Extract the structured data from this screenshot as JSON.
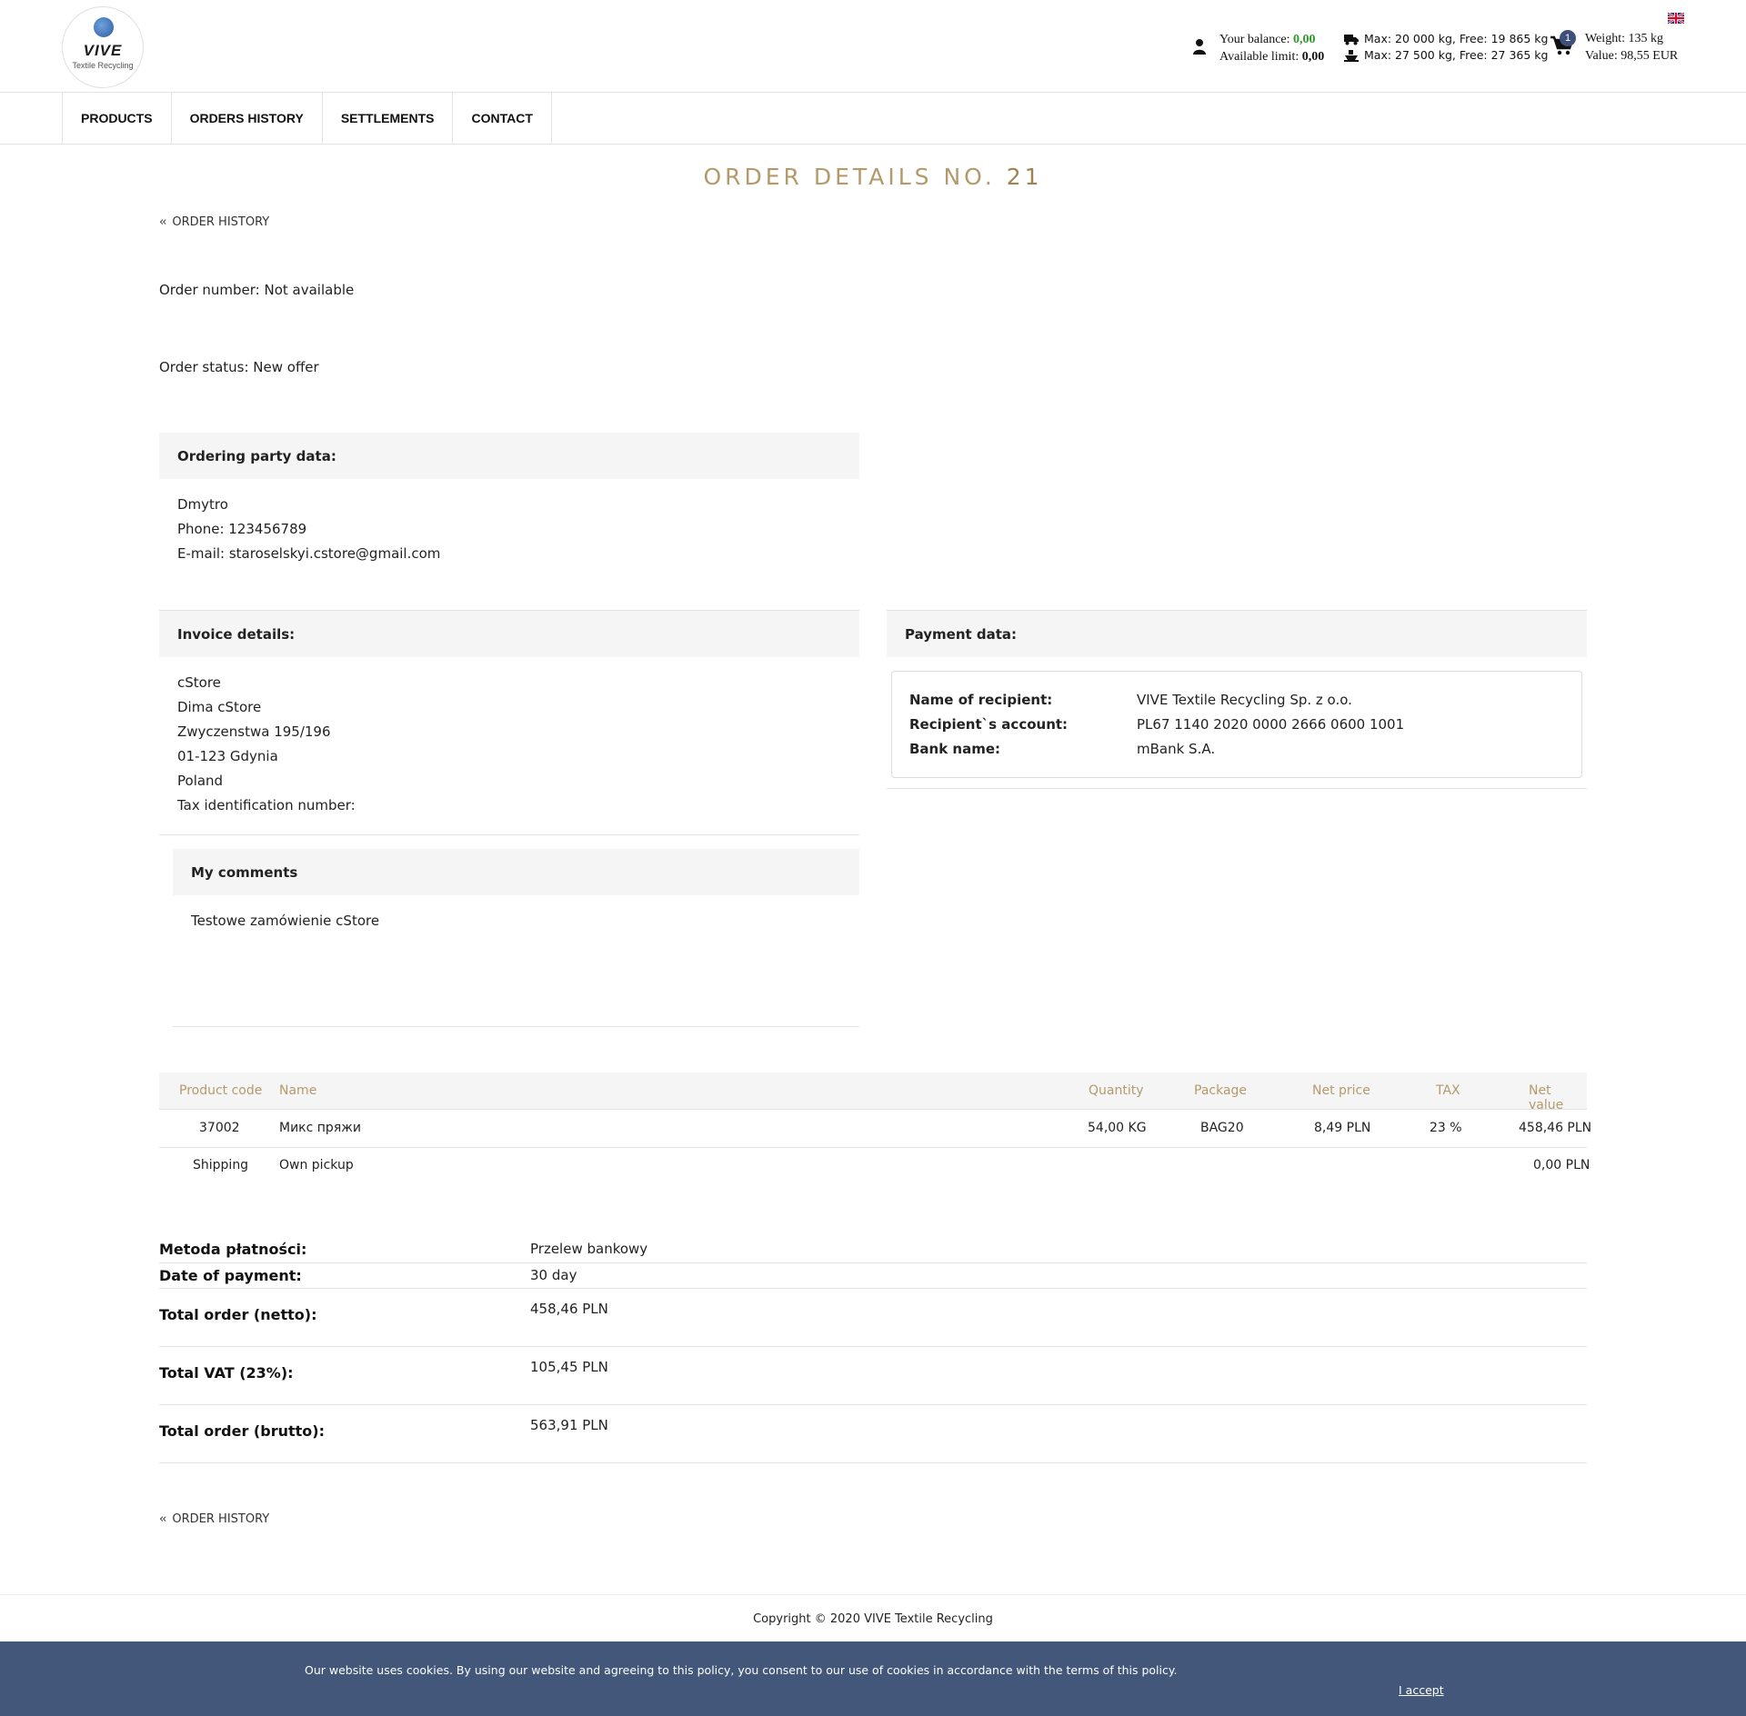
{
  "header": {
    "logo_brand": "VIVE",
    "logo_sub": "Textile Recycling",
    "balance_label": "Your balance:",
    "balance_value": "0,00",
    "limit_label": "Available limit:",
    "limit_value": "0,00",
    "truck1": "Max: 20 000 kg, Free: 19 865 kg",
    "truck2": "Max: 27 500 kg, Free: 27 365 kg",
    "cart_count": "1",
    "cart_weight": "Weight: 135 kg",
    "cart_value": "Value: 98,55 EUR"
  },
  "nav": {
    "items": [
      "PRODUCTS",
      "ORDERS HISTORY",
      "SETTLEMENTS",
      "CONTACT"
    ]
  },
  "page": {
    "title_prefix": "ORDER DETAILS NO.",
    "title_number": "21",
    "back_label": "ORDER HISTORY",
    "order_number": "Order number: Not available",
    "order_status": "Order status: New offer"
  },
  "ordering_party": {
    "heading": "Ordering party data:",
    "lines": [
      "Dmytro",
      "Phone: 123456789",
      "E-mail: staroselskyi.cstore@gmail.com"
    ]
  },
  "invoice": {
    "heading": "Invoice details:",
    "lines": [
      "cStore",
      "Dima cStore",
      "Zwyczenstwa 195/196",
      "01-123 Gdynia",
      "Poland",
      "Tax identification number:"
    ]
  },
  "payment": {
    "heading": "Payment data:",
    "rows": [
      {
        "k": "Name of recipient:",
        "v": "VIVE Textile Recycling Sp. z o.o."
      },
      {
        "k": "Recipient`s account:",
        "v": "PL67 1140 2020 0000 2666 0600 1001"
      },
      {
        "k": "Bank name:",
        "v": "mBank S.A."
      }
    ]
  },
  "comments": {
    "heading": "My comments",
    "text": "Testowe zamówienie cStore"
  },
  "table": {
    "headers": [
      "Product code",
      "Name",
      "Quantity",
      "Package",
      "Net price",
      "TAX",
      "Net value"
    ],
    "rows": [
      {
        "code": "37002",
        "name": "Микс пряжи",
        "qty": "54,00 KG",
        "pkg": "BAG20",
        "price": "8,49 PLN",
        "tax": "23 %",
        "value": "458,46 PLN"
      },
      {
        "code": "Shipping",
        "name": "Own pickup",
        "qty": "",
        "pkg": "",
        "price": "",
        "tax": "",
        "value": "0,00 PLN"
      }
    ]
  },
  "summary": [
    {
      "k": "Metoda płatności:",
      "v": "Przelew bankowy"
    },
    {
      "k": "Date of payment:",
      "v": "30 day"
    },
    {
      "k": "Total order (netto):",
      "v": "458,46 PLN"
    },
    {
      "k": "Total VAT (23%):",
      "v": "105,45 PLN"
    },
    {
      "k": "Total order (brutto):",
      "v": "563,91 PLN"
    }
  ],
  "footer": {
    "copyright": "Copyright © 2020 VIVE Textile Recycling"
  },
  "cookie": {
    "text": "Our website uses cookies. By using our website and agreeing to this policy, you consent to our use of cookies in accordance with the terms of this policy.",
    "accept": "I accept"
  }
}
